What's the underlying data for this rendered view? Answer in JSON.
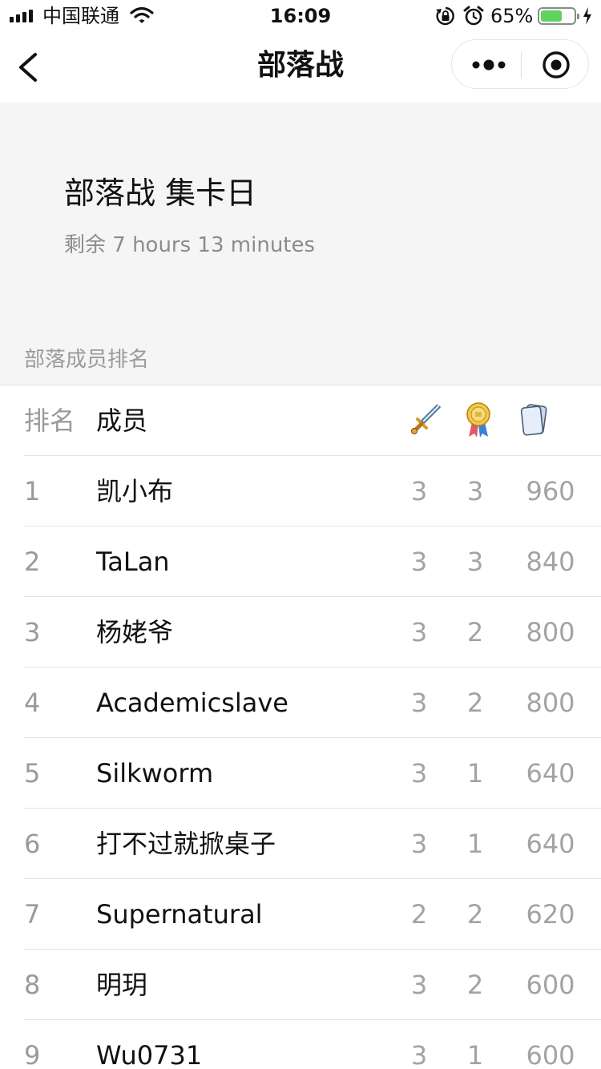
{
  "status_bar": {
    "carrier": "中国联通",
    "time": "16:09",
    "battery_percent": "65%",
    "battery_level": 0.65
  },
  "nav": {
    "title": "部落战"
  },
  "header": {
    "title": "部落战 集卡日",
    "remaining": "剩余 7 hours 13 minutes",
    "section_label": "部落成员排名"
  },
  "table": {
    "col_rank": "排名",
    "col_member": "成员",
    "icons": [
      "sword-icon",
      "medal-icon",
      "card-icon"
    ],
    "rows": [
      {
        "rank": "1",
        "name": "凯小布",
        "a": "3",
        "b": "3",
        "c": "960"
      },
      {
        "rank": "2",
        "name": "TaLan",
        "a": "3",
        "b": "3",
        "c": "840"
      },
      {
        "rank": "3",
        "name": "杨姥爷",
        "a": "3",
        "b": "2",
        "c": "800"
      },
      {
        "rank": "4",
        "name": "Academicslave",
        "a": "3",
        "b": "2",
        "c": "800"
      },
      {
        "rank": "5",
        "name": "Silkworm",
        "a": "3",
        "b": "1",
        "c": "640"
      },
      {
        "rank": "6",
        "name": "打不过就掀桌子",
        "a": "3",
        "b": "1",
        "c": "640"
      },
      {
        "rank": "7",
        "name": "Supernatural",
        "a": "2",
        "b": "2",
        "c": "620"
      },
      {
        "rank": "8",
        "name": "明玥",
        "a": "3",
        "b": "2",
        "c": "600"
      },
      {
        "rank": "9",
        "name": "Wu0731",
        "a": "3",
        "b": "1",
        "c": "600"
      }
    ]
  },
  "colors": {
    "header_bg": "#f5f5f5",
    "battery_fill": "#5fd35f",
    "muted_text": "#9a9a9a"
  }
}
